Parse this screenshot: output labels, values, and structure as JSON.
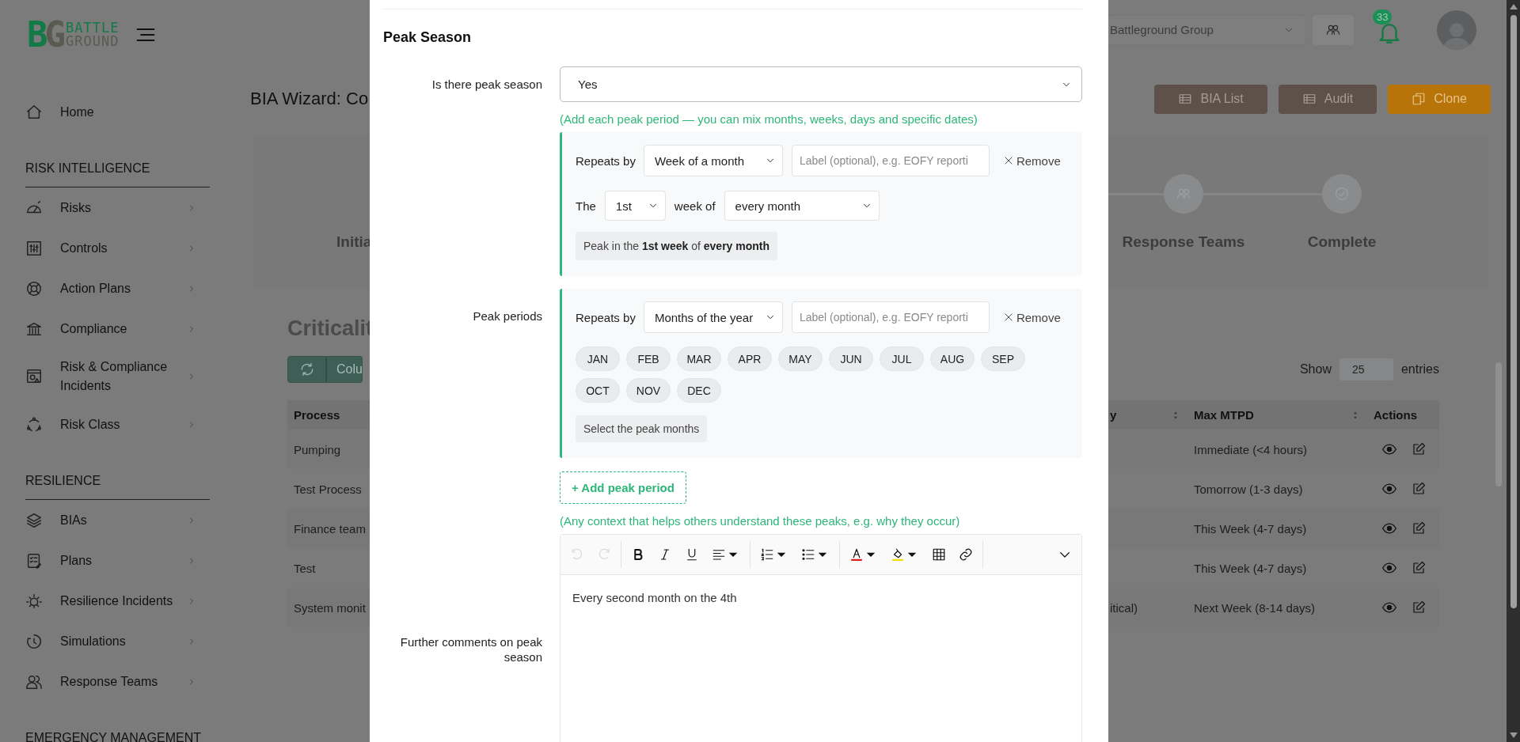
{
  "logo": {
    "mark": "BG",
    "line_1": "BATTLE",
    "line_2": "GROUND"
  },
  "sidebar": {
    "home": {
      "label": "Home"
    },
    "sections": [
      {
        "title": "RISK INTELLIGENCE",
        "items": [
          {
            "label": "Risks"
          },
          {
            "label": "Controls"
          },
          {
            "label": "Action Plans"
          },
          {
            "label": "Compliance"
          },
          {
            "label": "Risk & Compliance Incidents"
          },
          {
            "label": "Risk Class"
          }
        ]
      },
      {
        "title": "RESILIENCE",
        "items": [
          {
            "label": "BIAs"
          },
          {
            "label": "Plans"
          },
          {
            "label": "Resilience Incidents"
          },
          {
            "label": "Simulations"
          },
          {
            "label": "Response Teams"
          }
        ]
      },
      {
        "title": "EMERGENCY MANAGEMENT"
      }
    ]
  },
  "topbar": {
    "organization": "Battleground Group",
    "notifications": "33"
  },
  "page": {
    "title": "BIA Wizard: Co",
    "buttons": [
      {
        "label": "BIA List",
        "kind": "list"
      },
      {
        "label": "Audit",
        "kind": "list"
      },
      {
        "label": "Clone",
        "kind": "clone"
      }
    ],
    "steps": [
      {
        "label": "Initia"
      },
      {
        "label": "Response Teams"
      },
      {
        "label": "Complete"
      }
    ],
    "criticality": {
      "title": "Criticalit",
      "column_button": "Colu",
      "show_label": "Show",
      "page_size": "25",
      "entries_label": "entries",
      "columns": [
        {
          "label": "Process"
        },
        {
          "label": "y",
          "sortable": true
        },
        {
          "label": "Max MTPD",
          "sortable": true
        },
        {
          "label": "Actions",
          "sortable": false
        }
      ],
      "rows": [
        {
          "process": "Pumping",
          "max_mtpd": "Immediate (<4 hours)"
        },
        {
          "process": "Test Process",
          "max_mtpd": "Tomorrow (1-3 days)"
        },
        {
          "process": "Finance team",
          "max_mtpd": "This Week (4-7 days)"
        },
        {
          "process": "Test",
          "max_mtpd": "This Week (4-7 days)"
        },
        {
          "process": "System monit",
          "column_2": "itical)",
          "max_mtpd": "Next Week (8-14 days)"
        }
      ]
    }
  },
  "peak_season": {
    "heading": "Peak Season",
    "is_peak_label": "Is there peak season",
    "is_peak_value": "Yes",
    "periods_hint": "(Add each peak period — you can mix months, weeks, days and specific dates)",
    "periods_label": "Peak periods",
    "periods": [
      {
        "kind": "week",
        "repeats_label": "Repeats by",
        "repeats_value": "Week of a month",
        "label_placeholder": "Label (optional), e.g. EOFY reporti",
        "remove": "Remove",
        "the_label": "The",
        "week_value": "1st",
        "week_of_label": "week of",
        "month_value": "every month",
        "summary": "Peak in the **1st week** of **every month**"
      },
      {
        "kind": "months",
        "repeats_label": "Repeats by",
        "repeats_value": "Months of the year",
        "label_placeholder": "Label (optional), e.g. EOFY reporti",
        "remove": "Remove",
        "months": [
          {
            "label": "JAN",
            "selected": false
          },
          {
            "label": "FEB",
            "selected": false
          },
          {
            "label": "MAR",
            "selected": false
          },
          {
            "label": "APR",
            "selected": false
          },
          {
            "label": "MAY",
            "selected": false
          },
          {
            "label": "JUN",
            "selected": false
          },
          {
            "label": "JUL",
            "selected": false
          },
          {
            "label": "AUG",
            "selected": false
          },
          {
            "label": "SEP",
            "selected": false
          },
          {
            "label": "OCT",
            "selected": false
          },
          {
            "label": "NOV",
            "selected": false
          },
          {
            "label": "DEC",
            "selected": false
          }
        ],
        "summary": "Select the peak months"
      }
    ],
    "add_button": "+ Add peak period",
    "comments_hint": "(Any context that helps others understand these peaks, e.g. why they occur)",
    "comments_label": "Further comments on peak season",
    "toolbar": [
      {
        "kind": "undo",
        "disabled": true
      },
      {
        "kind": "redo",
        "disabled": true
      },
      {
        "kind": "bold",
        "disabled": false
      },
      {
        "kind": "italic",
        "disabled": false
      },
      {
        "kind": "underline",
        "disabled": false
      },
      {
        "kind": "align",
        "disabled": false
      },
      {
        "kind": "ordered-list",
        "disabled": false
      },
      {
        "kind": "bullet-list",
        "disabled": false
      },
      {
        "kind": "text-color",
        "disabled": false
      },
      {
        "kind": "highlight",
        "disabled": false
      },
      {
        "kind": "table",
        "disabled": false
      },
      {
        "kind": "link",
        "disabled": false
      },
      {
        "kind": "more",
        "disabled": false
      }
    ],
    "comments_value": "Every second month on the 4th"
  }
}
